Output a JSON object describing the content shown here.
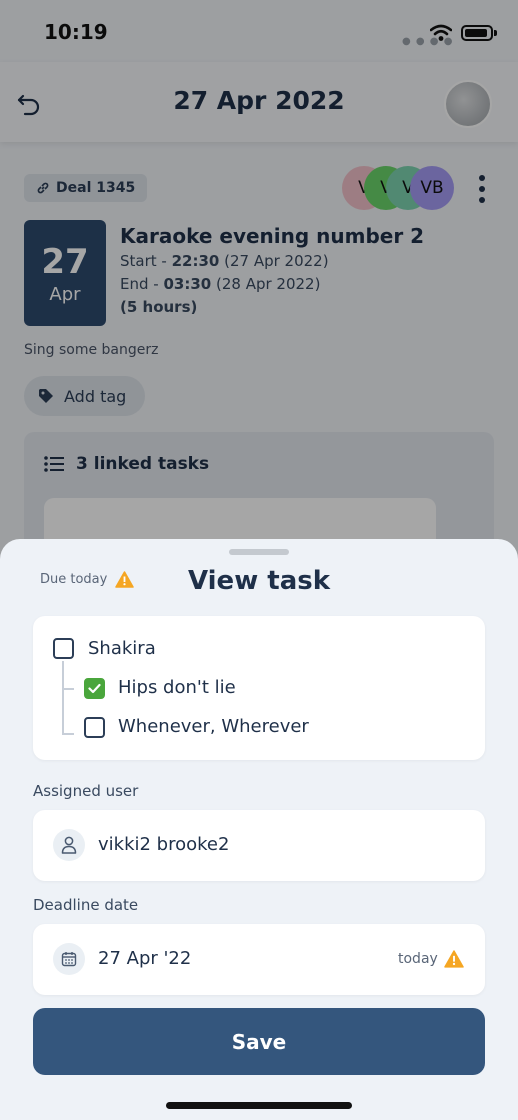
{
  "status_bar": {
    "time": "10:19"
  },
  "header": {
    "title": "27 Apr 2022"
  },
  "deal": {
    "label": "Deal 1345"
  },
  "participants": [
    {
      "initials": "V",
      "color": "#f2c1c9"
    },
    {
      "initials": "V",
      "color": "#6bd46a"
    },
    {
      "initials": "V",
      "color": "#7dd3b0"
    },
    {
      "initials": "VB",
      "color": "#a59cf4"
    }
  ],
  "event": {
    "day": "27",
    "month": "Apr",
    "title": "Karaoke evening number 2",
    "start_prefix": "Start - ",
    "start_time": "22:30",
    "start_date": " (27 Apr 2022)",
    "end_prefix": "End - ",
    "end_time": "03:30",
    "end_date": " (28 Apr 2022)",
    "duration": "(5 hours)",
    "description": "Sing some bangerz"
  },
  "tags": {
    "add_label": "Add tag"
  },
  "linked_tasks": {
    "title": "3 linked tasks"
  },
  "sheet": {
    "due_label": "Due today",
    "title": "View task",
    "task": {
      "name": "Shakira",
      "subtasks": [
        {
          "label": "Hips don't lie",
          "checked": true
        },
        {
          "label": "Whenever, Wherever",
          "checked": false
        }
      ]
    },
    "assigned_user": {
      "label": "Assigned user",
      "value": "vikki2 brooke2"
    },
    "deadline": {
      "label": "Deadline date",
      "value": "27 Apr '22",
      "status": "today"
    },
    "save_label": "Save"
  },
  "colors": {
    "primary": "#34567d",
    "success": "#4aa63c",
    "warning": "#f5a623"
  }
}
